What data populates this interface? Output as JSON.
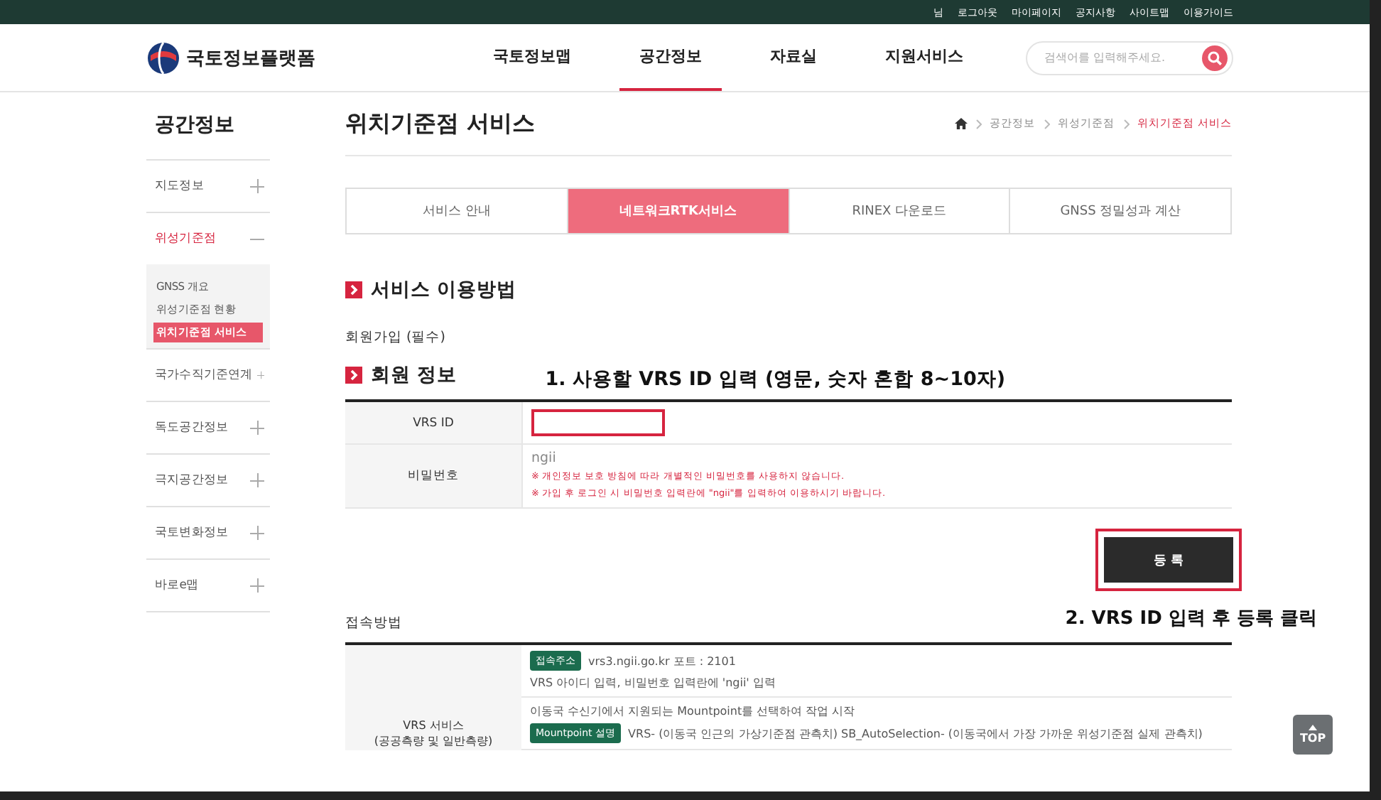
{
  "top_links": [
    "님",
    "로그아웃",
    "마이페이지",
    "공지사항",
    "사이트맵",
    "이용가이드"
  ],
  "logo": {
    "text": "국토정보플랫폼"
  },
  "nav": [
    {
      "label": "국토정보맵",
      "selected": false
    },
    {
      "label": "공간정보",
      "selected": true
    },
    {
      "label": "자료실",
      "selected": false
    },
    {
      "label": "지원서비스",
      "selected": false
    }
  ],
  "search": {
    "placeholder": "검색어를 입력해주세요."
  },
  "sidebar": {
    "title": "공간정보",
    "items": [
      {
        "label": "지도정보",
        "expanded": false
      },
      {
        "label": "위성기준점",
        "expanded": true,
        "children": [
          {
            "label": "GNSS 개요",
            "selected": false
          },
          {
            "label": "위성기준점 현황",
            "selected": false
          },
          {
            "label": "위치기준점 서비스",
            "selected": true
          }
        ]
      },
      {
        "label": "국가수직기준연계",
        "expanded": false
      },
      {
        "label": "독도공간정보",
        "expanded": false
      },
      {
        "label": "극지공간정보",
        "expanded": false
      },
      {
        "label": "국토변화정보",
        "expanded": false
      },
      {
        "label": "바로e맵",
        "expanded": false
      }
    ]
  },
  "page_title": "위치기준점 서비스",
  "breadcrumb": [
    {
      "label": "공간정보",
      "current": false
    },
    {
      "label": "위성기준점",
      "current": false
    },
    {
      "label": "위치기준점 서비스",
      "current": true
    }
  ],
  "tabs": [
    {
      "label": "서비스 안내",
      "selected": false
    },
    {
      "label": "네트워크RTK서비스",
      "selected": true
    },
    {
      "label": "RINEX 다운로드",
      "selected": false
    },
    {
      "label": "GNSS 정밀성과 계산",
      "selected": false
    }
  ],
  "section_title": "서비스 이용방법",
  "signup_label": "회원가입 (필수)",
  "member_title": "회원 정보",
  "annotation_1": "1. 사용할 VRS ID 입력 (영문, 숫자 혼합 8~10자)",
  "member_form": {
    "id_label": "VRS ID",
    "id_highlighted": true,
    "password_label": "비밀번호",
    "password_value": "ngii",
    "notes": [
      "※ 개인정보 보호 방침에 따라 개별적인 비밀번호를 사용하지 않습니다.",
      "※ 가입 후 로그인 시 비밀번호 입력란에 \"ngii\"를 입력하여 이용하시기 바랍니다."
    ]
  },
  "register_button": {
    "label": "등 록",
    "highlighted": true
  },
  "connect_label": "접속방법",
  "annotation_2": "2. VRS ID 입력 후 등록 클릭",
  "connect_table": {
    "row_label": "VRS 서비스",
    "row_sublabel": "(공공측량 및 일반측량)",
    "blocks": [
      {
        "lines": [
          {
            "tag": "접속주소",
            "text": "vrs3.ngii.go.kr 포트 : 2101"
          },
          {
            "text": "VRS 아이디 입력, 비밀번호 입력란에 'ngii' 입력"
          }
        ]
      },
      {
        "lines": [
          {
            "text": "이동국 수신기에서 지원되는 Mountpoint를 선택하여 작업 시작"
          },
          {
            "tag": "Mountpoint 설명",
            "text": "VRS- (이동국 인근의 가상기준점 관측치) SB_AutoSelection- (이동국에서 가장 가까운 위성기준점 실제 관측치)"
          }
        ]
      }
    ]
  },
  "top_button": {
    "label": "TOP"
  }
}
